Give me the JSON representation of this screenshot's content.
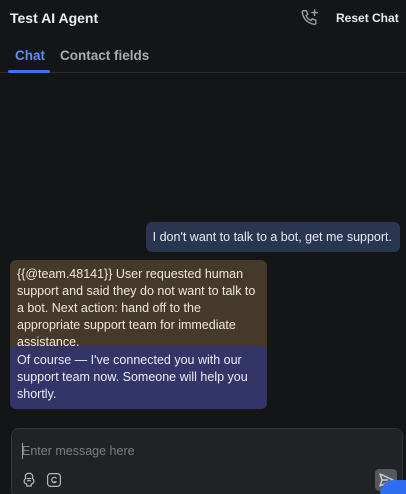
{
  "header": {
    "title": "Test AI Agent",
    "call_icon": "phone-plus-icon",
    "reset_label": "Reset Chat"
  },
  "tabs": [
    {
      "label": "Chat",
      "active": true
    },
    {
      "label": "Contact fields",
      "active": false
    }
  ],
  "messages": [
    {
      "role": "user",
      "text": "I don't want to talk to a bot, get me support."
    },
    {
      "role": "internal-note",
      "text": "{{@team.48141}} User requested human support and said they do not want to talk to a bot. Next action: hand off to the appropriate support team for immediate assistance."
    },
    {
      "role": "assistant",
      "text": "Of course — I've connected you with our support team now. Someone will help you shortly."
    }
  ],
  "composer": {
    "placeholder": "Enter message here",
    "tools": [
      "ai-assist-icon",
      "gif-icon"
    ],
    "send_icon": "send-icon"
  },
  "colors": {
    "background": "#141517",
    "accent": "#3d72f0",
    "user_bubble": "#2a3550",
    "note_bubble": "#45392a",
    "assistant_bubble": "#333468"
  }
}
